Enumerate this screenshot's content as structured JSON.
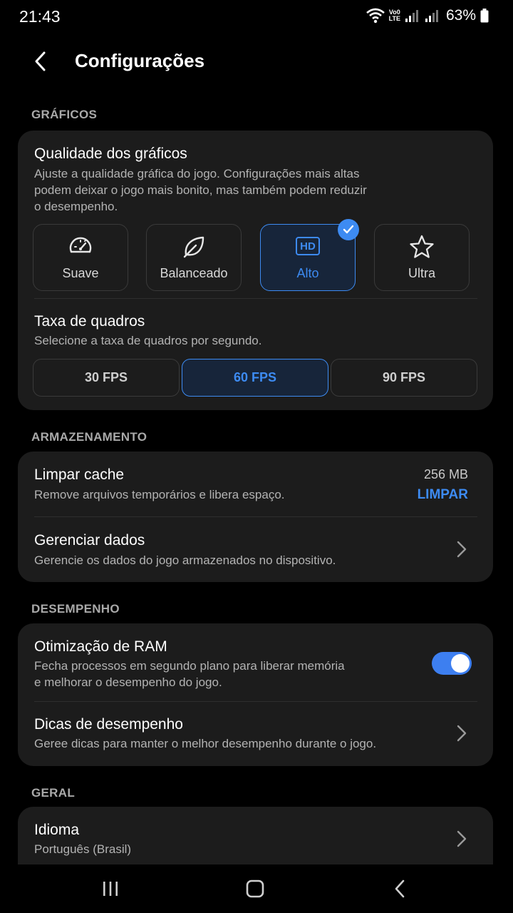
{
  "status_bar": {
    "time": "21:43",
    "network_label_top": "Vo0",
    "network_label_bottom": "LTE",
    "battery": "63%"
  },
  "header": {
    "title": "Configurações",
    "back_icon": "chevron-left-icon"
  },
  "graphics": {
    "section_label": "GRÁFICOS",
    "quality": {
      "title": "Qualidade dos gráficos",
      "description_lines": [
        "Ajuste a qualidade gráfica do jogo. Configurações mais altas",
        "podem deixar o jogo mais bonito, mas também podem reduzir",
        "o desempenho."
      ],
      "options": [
        {
          "label": "Suave",
          "icon": "speedometer-icon",
          "selected": false
        },
        {
          "label": "Balanceado",
          "icon": "leaf-icon",
          "selected": false
        },
        {
          "label": "Alto",
          "icon": "hd-icon",
          "icon_text": "HD",
          "selected": true
        },
        {
          "label": "Ultra",
          "icon": "star-icon",
          "selected": false
        }
      ]
    },
    "frame_rate": {
      "title": "Taxa de quadros",
      "description": "Selecione a taxa de quadros por segundo.",
      "options": [
        {
          "label": "30 FPS",
          "selected": false
        },
        {
          "label": "60 FPS",
          "selected": true
        },
        {
          "label": "90 FPS",
          "selected": false
        }
      ]
    }
  },
  "storage": {
    "section_label": "ARMAZENAMENTO",
    "clear_cache": {
      "title": "Limpar cache",
      "description": "Remove arquivos temporários e libera espaço.",
      "size": "256 MB",
      "action": "LIMPAR"
    },
    "manage_data": {
      "title": "Gerenciar dados",
      "description": "Gerencie os dados do jogo armazenados no dispositivo."
    }
  },
  "performance": {
    "section_label": "DESEMPENHO",
    "ram_optimization": {
      "title": "Otimização de RAM",
      "description_lines": [
        "Fecha processos em segundo plano para liberar memória",
        "e melhorar o desempenho do jogo."
      ],
      "enabled": true
    },
    "tips": {
      "title": "Dicas de desempenho",
      "description": "Geree dicas para manter o melhor desempenho durante o jogo."
    }
  },
  "general": {
    "section_label": "GERAL",
    "language": {
      "title": "Idioma",
      "value": "Português (Brasil)"
    }
  },
  "colors": {
    "accent": "#3d8bf2",
    "card": "#1c1c1c",
    "background": "#000000"
  },
  "nav_bar": {
    "icons": [
      "recents-icon",
      "home-icon",
      "back-icon"
    ]
  }
}
